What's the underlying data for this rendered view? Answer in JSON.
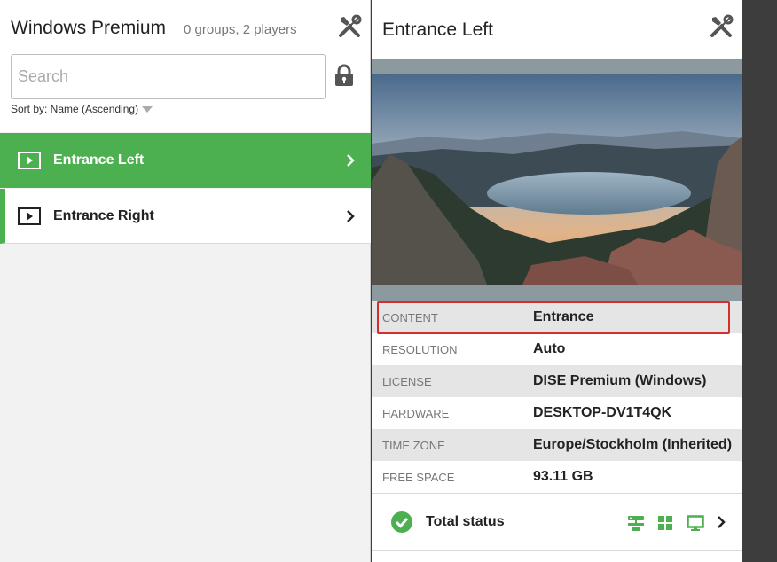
{
  "left": {
    "title": "Windows Premium",
    "count": "0 groups, 2 players",
    "search_placeholder": "Search",
    "sort_label": "Sort by: Name (Ascending)",
    "players": [
      {
        "name": "Entrance Left",
        "selected": true
      },
      {
        "name": "Entrance Right",
        "selected": false
      }
    ]
  },
  "detail": {
    "title": "Entrance Left",
    "properties": [
      {
        "key": "CONTENT",
        "value": "Entrance"
      },
      {
        "key": "RESOLUTION",
        "value": "Auto"
      },
      {
        "key": "LICENSE",
        "value": "DISE Premium (Windows)"
      },
      {
        "key": "HARDWARE",
        "value": "DESKTOP-DV1T4QK"
      },
      {
        "key": "TIME ZONE",
        "value": "Europe/Stockholm (Inherited)"
      },
      {
        "key": "FREE SPACE",
        "value": "93.11 GB"
      }
    ],
    "status_label": "Total status"
  },
  "icons": {
    "tools": "tools-icon",
    "lock": "lock-icon",
    "player": "player-screen-icon",
    "chevron": "chevron-right-icon",
    "check": "check-circle-icon",
    "network": "network-icon",
    "apps": "grid-apps-icon",
    "display": "monitor-icon"
  },
  "colors": {
    "accent": "#4caf50",
    "highlight": "#d32f2f"
  }
}
